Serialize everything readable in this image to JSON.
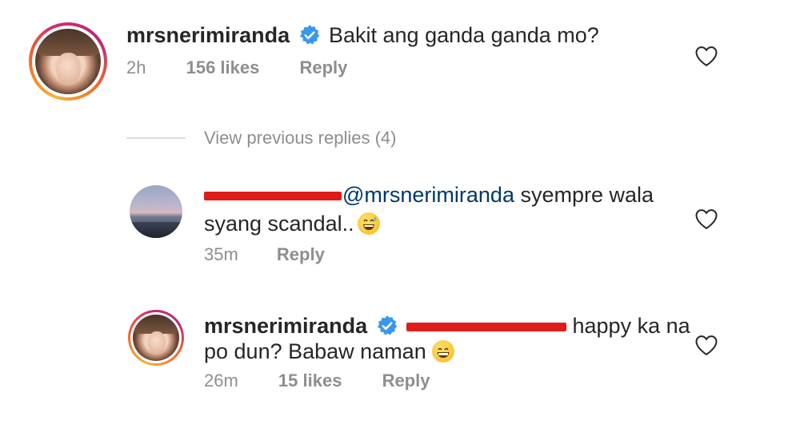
{
  "comments": [
    {
      "username": "mrsnerimiranda",
      "verified": true,
      "text": "Bakit ang ganda ganda mo?",
      "time": "2h",
      "likes": "156 likes",
      "reply": "Reply"
    }
  ],
  "view_replies": "View previous replies (4)",
  "replies": [
    {
      "username": "",
      "mention": "@mrsnerimiranda",
      "text_line1": " syempre wala",
      "text_line2": "syang scandal..",
      "emoji": "grinning-sweat-emoji",
      "time": "35m",
      "reply": "Reply"
    },
    {
      "username": "mrsnerimiranda",
      "verified": true,
      "text_line1": " happy ka na",
      "text_line2": "po dun? Babaw naman ",
      "emoji": "beaming-grin-emoji",
      "time": "26m",
      "likes": "15 likes",
      "reply": "Reply"
    }
  ],
  "colors": {
    "username": "#262626",
    "meta": "#8e8e8e",
    "verified": "#3897f0",
    "redaction": "#e11a1a",
    "mention": "#00376b"
  }
}
